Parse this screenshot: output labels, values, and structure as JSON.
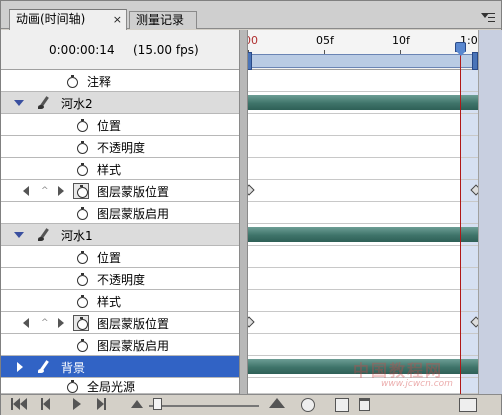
{
  "tabs": [
    {
      "label": "动画(时间轴)",
      "close": "×"
    },
    {
      "label": "测量记录"
    }
  ],
  "header": {
    "timecode": "0:00:00:14",
    "fps": "(15.00 fps)"
  },
  "ruler": {
    "labels": [
      "00",
      "05f",
      "10f",
      "1:0"
    ]
  },
  "layers": [
    {
      "name": "注释",
      "kind": "comment"
    },
    {
      "name": "河水2",
      "kind": "group"
    },
    {
      "name": "位置",
      "kind": "prop"
    },
    {
      "name": "不透明度",
      "kind": "prop"
    },
    {
      "name": "样式",
      "kind": "prop"
    },
    {
      "name": "图层蒙版位置",
      "kind": "prop-key"
    },
    {
      "name": "图层蒙版启用",
      "kind": "prop"
    },
    {
      "name": "河水1",
      "kind": "group"
    },
    {
      "name": "位置",
      "kind": "prop"
    },
    {
      "name": "不透明度",
      "kind": "prop"
    },
    {
      "name": "样式",
      "kind": "prop"
    },
    {
      "name": "图层蒙版位置",
      "kind": "prop-key"
    },
    {
      "name": "图层蒙版启用",
      "kind": "prop"
    },
    {
      "name": "背景",
      "kind": "group-selected"
    },
    {
      "name": "全局光源",
      "kind": "comment"
    }
  ],
  "current_frame_fraction": 0.93,
  "watermark": {
    "text": "中国教程网",
    "url": "www.jcwcn.com"
  },
  "colors": {
    "selection": "#3163c5",
    "duration_bar": "#3f746a",
    "playhead": "#b01818"
  },
  "icons": [
    "stopwatch-icon",
    "brush-icon",
    "expand-arrow-icon",
    "keyframe-diamond-icon",
    "prev-keyframe-icon",
    "next-keyframe-icon",
    "panel-menu-icon",
    "first-frame-icon",
    "prev-frame-icon",
    "play-icon",
    "next-frame-icon",
    "zoom-out-icon",
    "zoom-in-icon",
    "tween-icon",
    "duplicate-icon",
    "trash-icon",
    "convert-icon"
  ]
}
